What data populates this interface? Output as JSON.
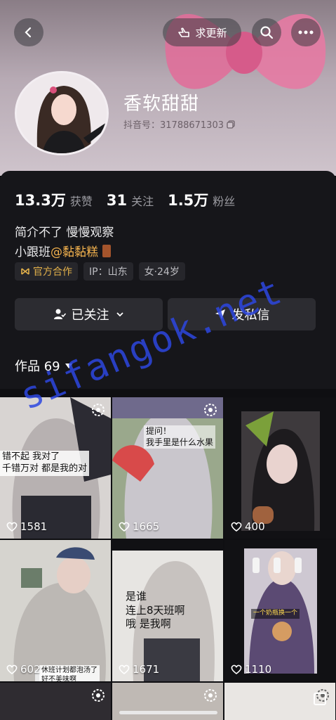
{
  "header": {
    "refresh_label": "求更新",
    "back_icon": "chevron-left-icon",
    "search_icon": "search-icon",
    "more_icon": "more-icon"
  },
  "profile": {
    "name": "香软甜甜",
    "douyin_id": "抖音号：31788671303"
  },
  "stats": [
    {
      "num": "13.3万",
      "label": "获赞"
    },
    {
      "num": "31",
      "label": "关注"
    },
    {
      "num": "1.5万",
      "label": "粉丝"
    }
  ],
  "bio": {
    "line1": "简介不了 慢慢观察",
    "line2_prefix": "小跟班",
    "mention": "@黏黏糕"
  },
  "tags": [
    {
      "label": "官方合作"
    },
    {
      "label": "IP：山东"
    },
    {
      "label": "女·24岁"
    }
  ],
  "actions": {
    "follow_label": "已关注",
    "message_label": "发私信"
  },
  "works": {
    "label": "作品 69"
  },
  "videos": [
    {
      "likes": "1581",
      "caption": "错不起 我对了\n千错万对 都是我的对"
    },
    {
      "likes": "1665",
      "caption": "提问！\n我手里是什么水果"
    },
    {
      "likes": "400",
      "caption": ""
    },
    {
      "likes": "602",
      "caption": "休班计划都泡汤了\n好不美味啊"
    },
    {
      "likes": "1671",
      "caption": "是谁\n连上8天班啊\n哦 是我啊"
    },
    {
      "likes": "1110",
      "caption": "一个奶瓶换一个"
    }
  ],
  "watermark": "sifangok.net",
  "colors": {
    "mention": "#f3b24e",
    "official_tag": "#e2b04a",
    "watermark": "#2d46e1",
    "panel_bg": "#16161a"
  }
}
